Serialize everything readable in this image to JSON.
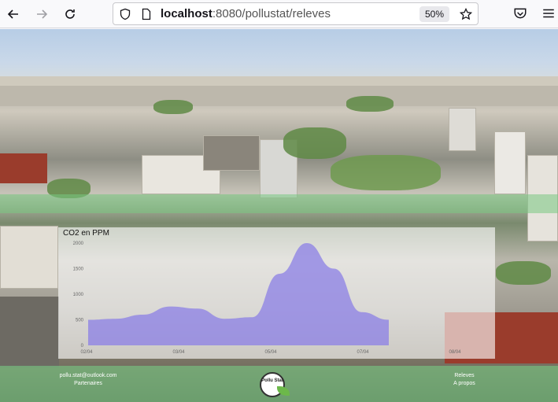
{
  "browser": {
    "url_host": "localhost",
    "url_path": ":8080/pollustat/releves",
    "zoom": "50%"
  },
  "icons": [
    "back-icon",
    "forward-icon",
    "reload-icon",
    "shield-icon",
    "page-icon",
    "star-icon",
    "pocket-icon",
    "menu-icon"
  ],
  "chart_data": {
    "type": "area",
    "title": "CO2 en PPM",
    "x": [
      "02/04",
      "02/20",
      "03/04",
      "03/15",
      "03/20",
      "04/01",
      "04/20",
      "05/04",
      "05/20",
      "06/04",
      "06/20",
      "07/04"
    ],
    "y": [
      500,
      520,
      600,
      760,
      720,
      520,
      550,
      1400,
      2000,
      1500,
      650,
      500
    ],
    "x_tick_labels": [
      "02/04",
      "03/04",
      "05/04",
      "07/04",
      "08/04"
    ],
    "y_tick_labels": [
      "0",
      "500",
      "1000",
      "1500",
      "2000"
    ],
    "ylim": [
      0,
      2000
    ],
    "color": "#8b7fe6"
  },
  "footer": {
    "email": "pollu.stat@outlook.com",
    "partners": "Partenaires",
    "logo_text": "Pollu Stat",
    "releves": "Releves",
    "apropos": "A propos"
  },
  "colors": {
    "accent_green": "#78c882",
    "chart_fill": "#8b7fe6"
  }
}
